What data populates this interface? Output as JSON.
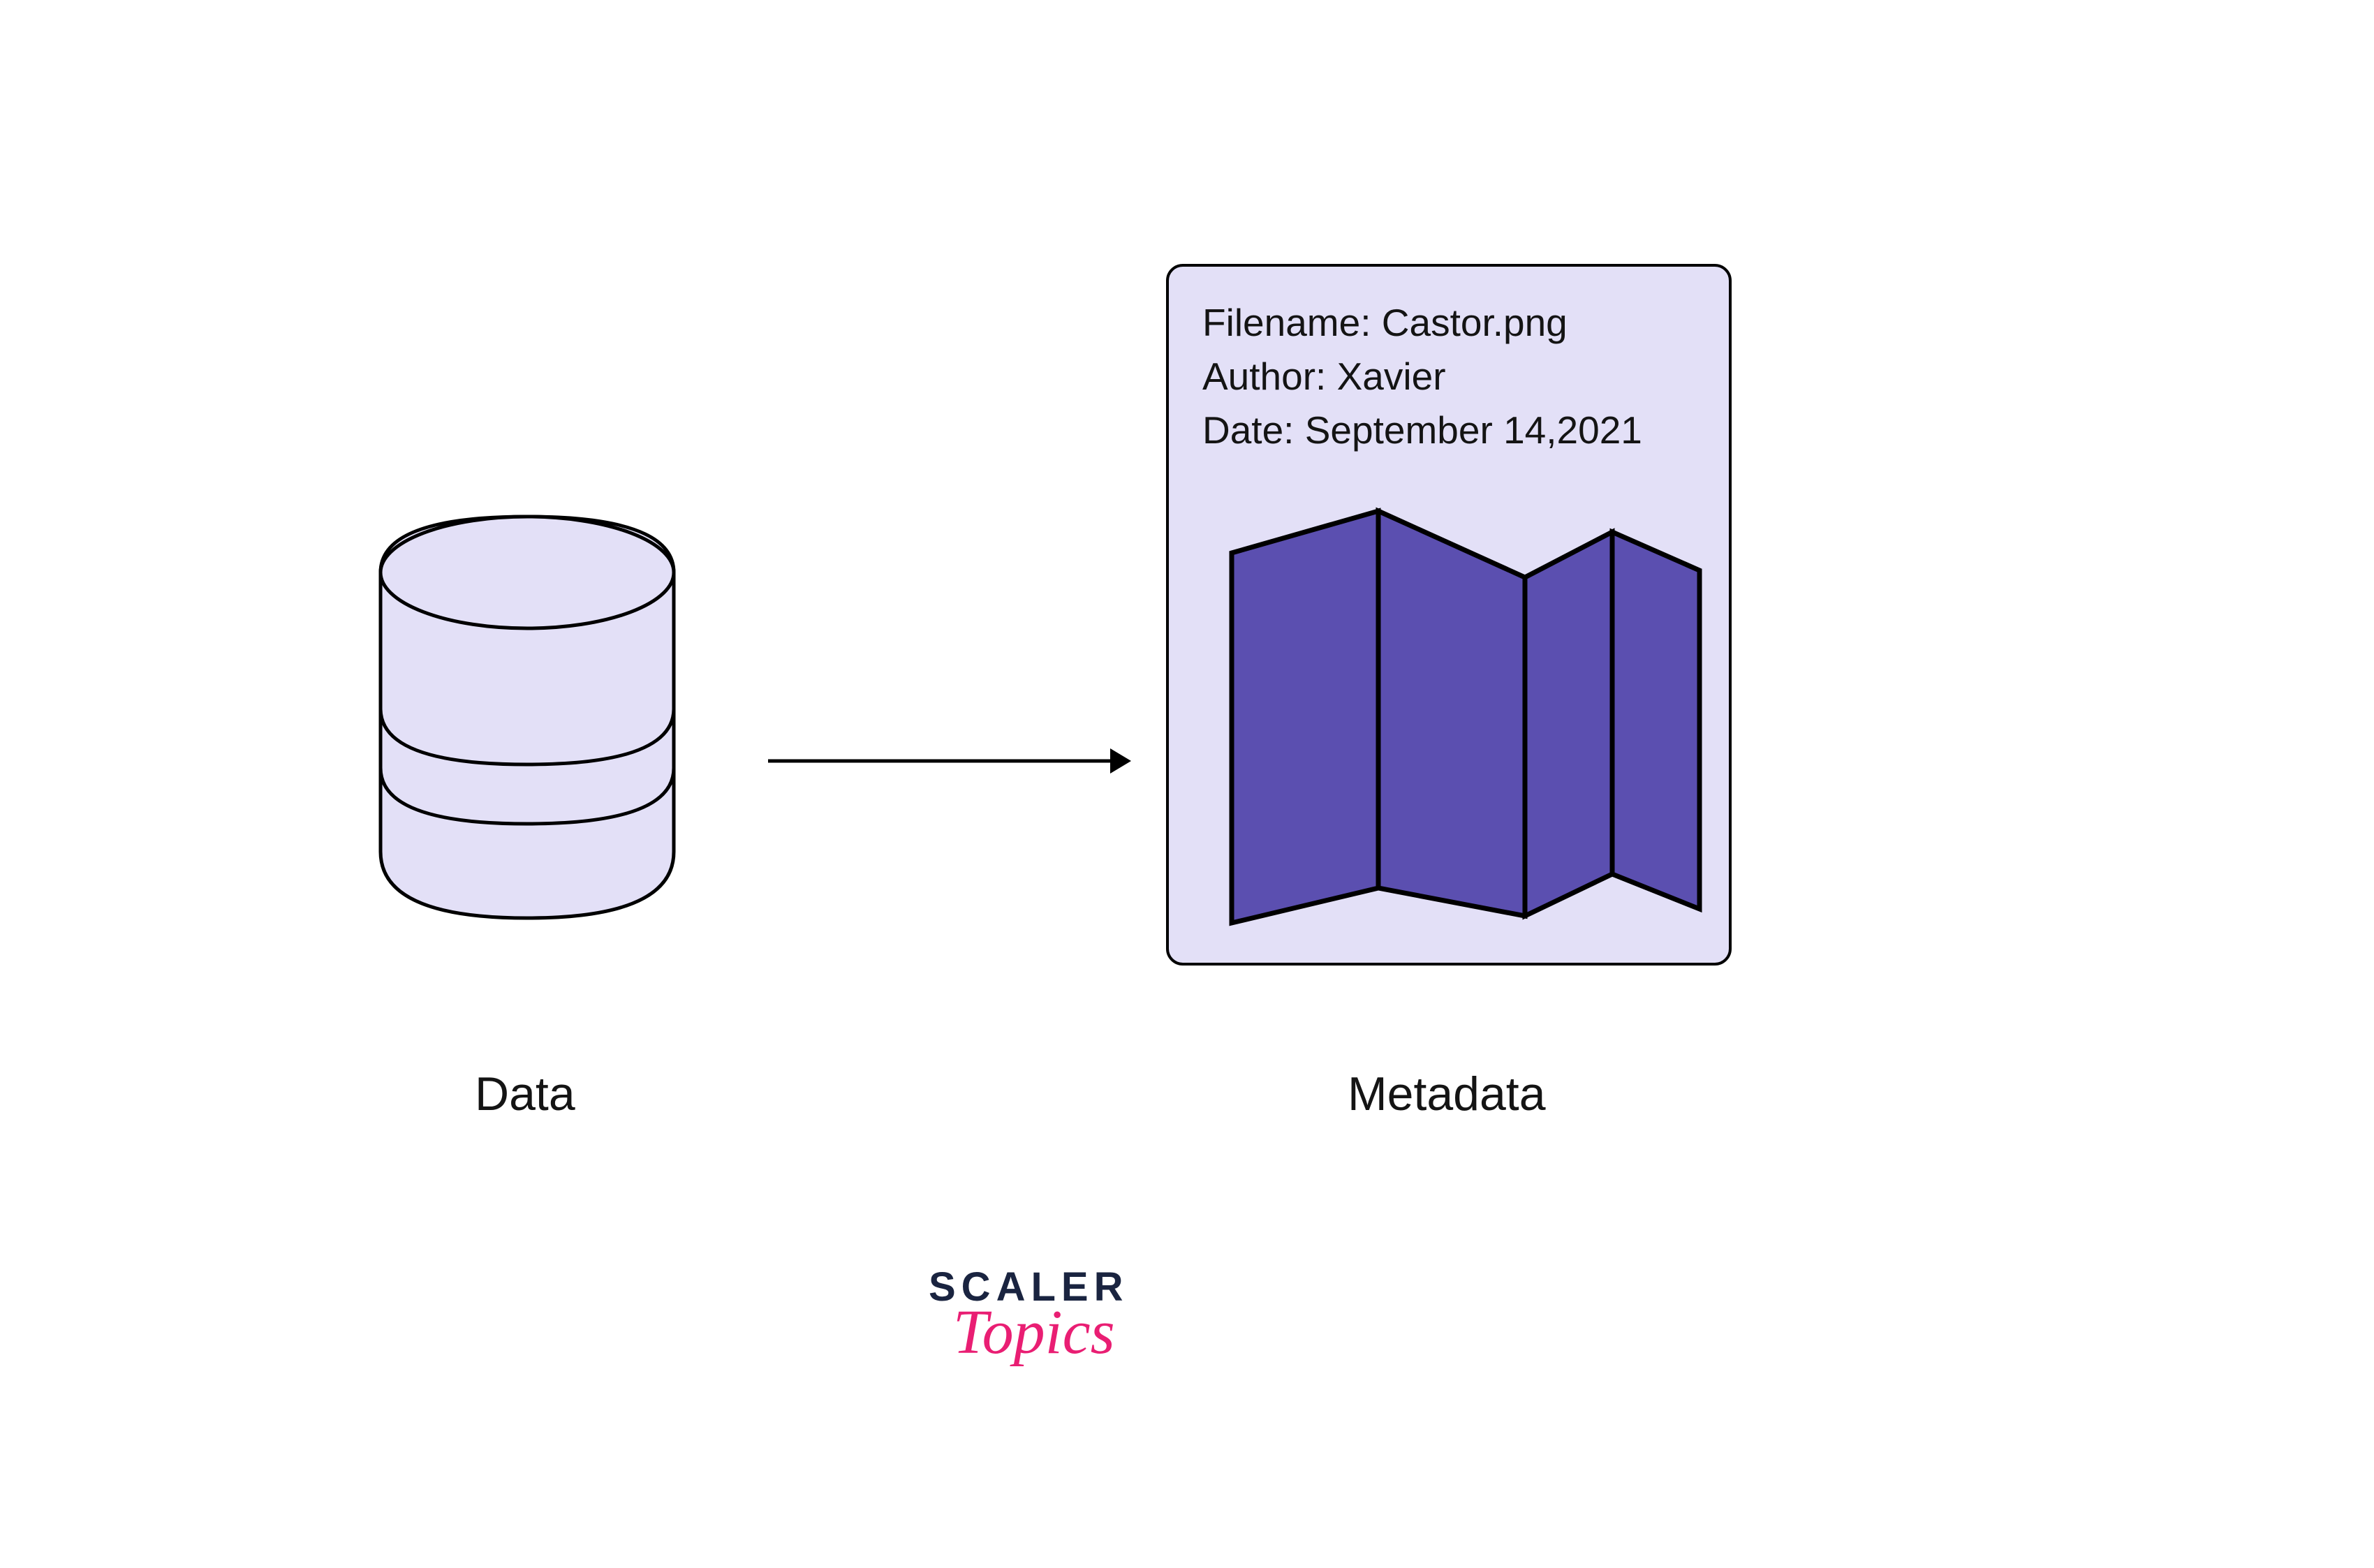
{
  "labels": {
    "data": "Data",
    "metadata": "Metadata"
  },
  "metadata_card": {
    "filename_label": "Filename:",
    "filename_value": "Castor.png",
    "author_label": "Author:",
    "author_value": "Xavier",
    "date_label": "Date:",
    "date_value": "September 14,2021"
  },
  "brand": {
    "line1": "SCALER",
    "line2": "Topics"
  },
  "colors": {
    "card_bg": "#e3e0f7",
    "cylinder_fill": "#e3e0f7",
    "map_fill": "#5b4fb0",
    "brand_dark": "#1a2440",
    "brand_pink": "#e91e73"
  }
}
